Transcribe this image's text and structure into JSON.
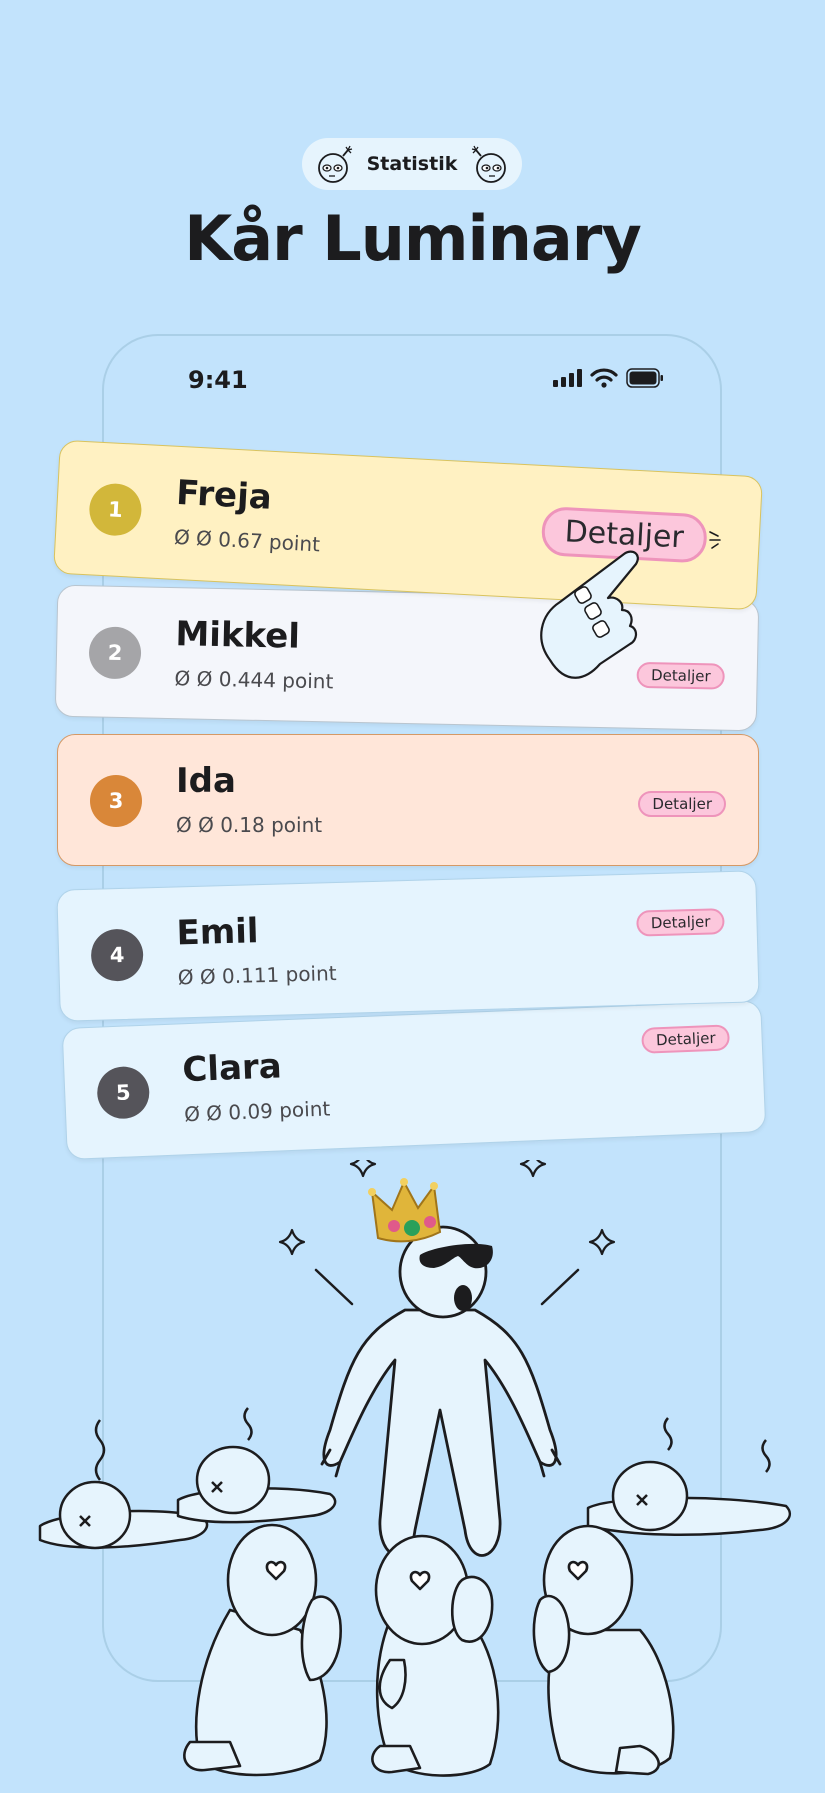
{
  "header": {
    "pill_label": "Statistik",
    "title": "Kår Luminary"
  },
  "status_bar": {
    "time": "9:41"
  },
  "leaderboard": [
    {
      "rank": "1",
      "name": "Freja",
      "score": "Ø Ø 0.67 point",
      "details_label": "Detaljer",
      "rank_color": "#d2b73a",
      "card_color": "#fff1c2",
      "border_color": "#d9c35e"
    },
    {
      "rank": "2",
      "name": "Mikkel",
      "score": "Ø Ø 0.444 point",
      "details_label": "Detaljer",
      "rank_color": "#a5a5a8",
      "card_color": "#f4f6fb",
      "border_color": "#b9c5cf"
    },
    {
      "rank": "3",
      "name": "Ida",
      "score": "Ø Ø 0.18 point",
      "details_label": "Detaljer",
      "rank_color": "#d98739",
      "card_color": "#ffe6d9",
      "border_color": "#d59966"
    },
    {
      "rank": "4",
      "name": "Emil",
      "score": "Ø Ø 0.111 point",
      "details_label": "Detaljer",
      "rank_color": "#55545a",
      "card_color": "#e5f4fe",
      "border_color": "#b0d3ea"
    },
    {
      "rank": "5",
      "name": "Clara",
      "score": "Ø Ø 0.09 point",
      "details_label": "Detaljer",
      "rank_color": "#55545a",
      "card_color": "#e5f4fe",
      "border_color": "#b0d3ea"
    }
  ]
}
